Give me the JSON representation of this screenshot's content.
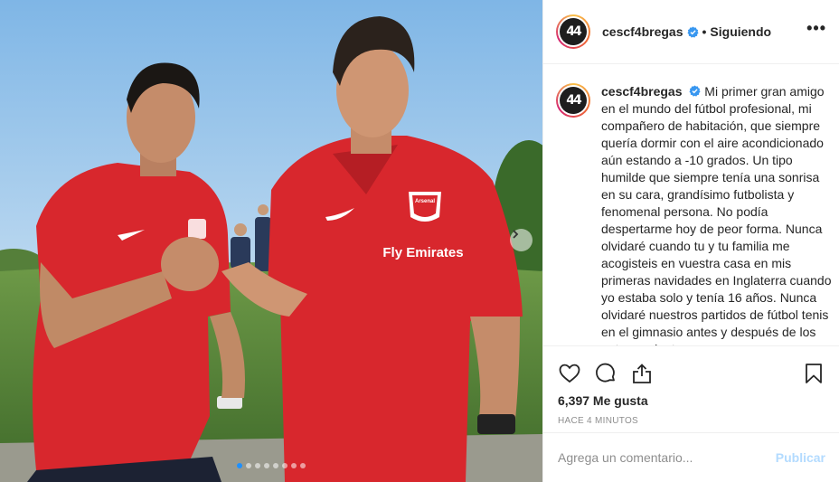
{
  "post": {
    "image_alt": "",
    "jersey_sponsor": "Fly Emirates",
    "crest_text": "Arsenal",
    "carousel": {
      "dot_count": 8,
      "active_index": 0
    }
  },
  "author": {
    "username": "cescf4bregas",
    "avatar_text": "4",
    "follow_status": "Siguiendo",
    "separator": "•"
  },
  "caption": {
    "text": "Mi primer gran amigo en el mundo del fútbol profesional, mi compañero de habitación, que siempre quería dormir con el aire acondicionado aún estando a -10 grados. Un tipo humilde que siempre tenía una sonrisa en su cara, grandísimo futbolista y fenomenal persona. No podía despertarme hoy de peor forma. Nunca olvidaré cuando tu y tu familia me acogisteis en vuestra casa en mis primeras navidades en Inglaterra cuando yo estaba solo y tenía 16 años. Nunca olvidaré nuestros partidos de fútbol tenis en el gimnasio antes y después de los entrenamientos"
  },
  "stats": {
    "likes": "6,397 Me gusta",
    "time": "HACE 4 MINUTOS"
  },
  "comment": {
    "placeholder": "Agrega un comentario...",
    "publish_label": "Publicar"
  },
  "icons": {
    "like": "heart-icon",
    "comment": "comment-icon",
    "share": "share-icon",
    "save": "bookmark-icon",
    "more": "more-options-icon",
    "verified": "verified-badge-icon",
    "next": "chevron-right-icon"
  },
  "colors": {
    "jersey": "#d8272d",
    "verified": "#3897f0",
    "publish_disabled": "#b3dbff",
    "secondary_text": "#8e8e8e"
  }
}
